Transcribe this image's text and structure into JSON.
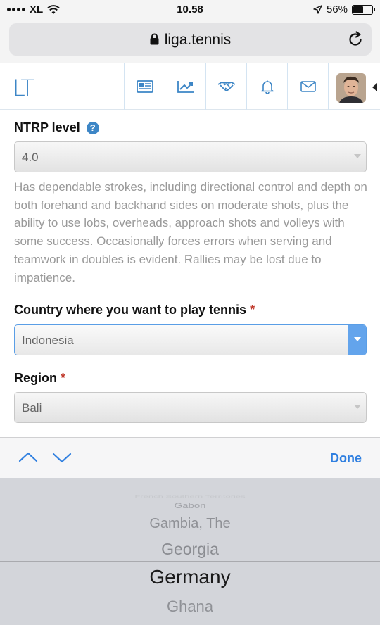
{
  "status_bar": {
    "carrier": "XL",
    "time": "10.58",
    "battery": "56%",
    "battery_level": 0.56
  },
  "browser": {
    "url": "liga.tennis"
  },
  "header": {
    "logo": "LT",
    "nav_icons": [
      "news-icon",
      "chart-icon",
      "handshake-icon",
      "bell-icon",
      "mail-icon"
    ]
  },
  "form": {
    "ntrp": {
      "label": "NTRP level",
      "help_glyph": "?",
      "value": "4.0",
      "description": "Has dependable strokes, including directional control and depth on both forehand and backhand sides on moderate shots, plus the ability to use lobs, overheads, approach shots and volleys with some success. Occasionally forces errors when serving and teamwork in doubles is evident. Rallies may be lost due to impatience."
    },
    "country": {
      "label": "Country where you want to play tennis",
      "required_mark": "*",
      "value": "Indonesia"
    },
    "region": {
      "label": "Region",
      "required_mark": "*",
      "value": "Bali"
    }
  },
  "picker": {
    "done_label": "Done",
    "items": [
      "French Southern Territories",
      "Gabon",
      "Gambia, The",
      "Georgia",
      "Germany",
      "Ghana"
    ],
    "selected": "Germany"
  },
  "colors": {
    "accent": "#3d86c6",
    "ios_blue": "#2f7fe0",
    "required": "#c0392b"
  }
}
